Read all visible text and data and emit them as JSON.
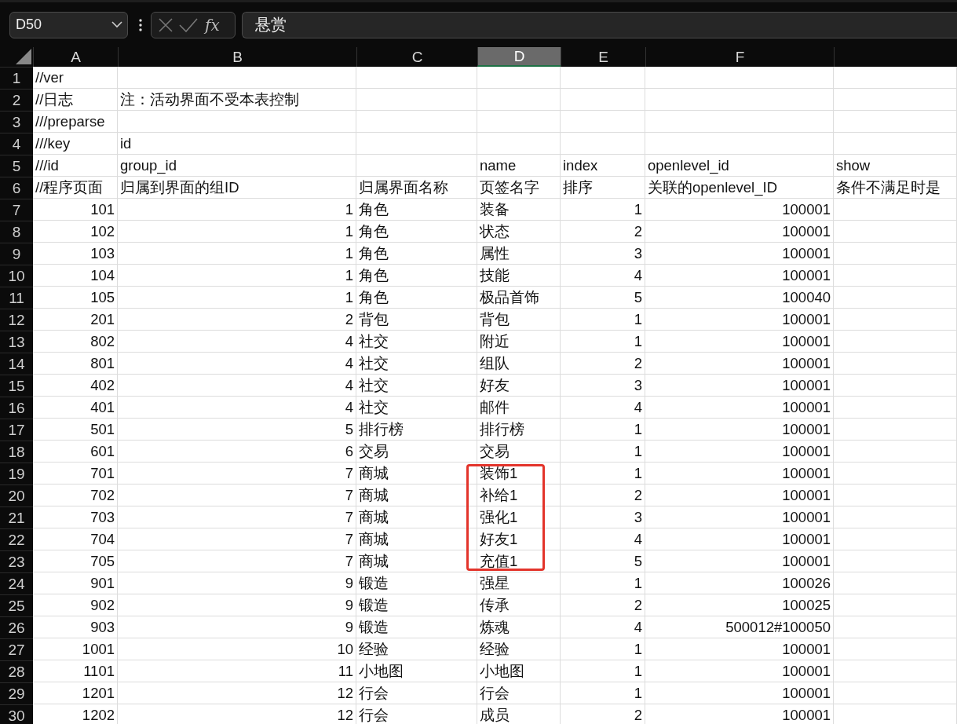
{
  "formula_bar": {
    "name_box": "D50",
    "function_label": "fx",
    "formula": "悬赏"
  },
  "columns": [
    {
      "label": "A",
      "selected": false
    },
    {
      "label": "B",
      "selected": false
    },
    {
      "label": "C",
      "selected": false
    },
    {
      "label": "D",
      "selected": true
    },
    {
      "label": "E",
      "selected": false
    },
    {
      "label": "F",
      "selected": false
    },
    {
      "selected": false
    }
  ],
  "rows": [
    {
      "number": "1",
      "kind": "header",
      "cells": [
        "//ver",
        null,
        null,
        null,
        null,
        null,
        null
      ]
    },
    {
      "number": "2",
      "kind": "header",
      "cells": [
        "//日志",
        "注：活动界面不受本表控制",
        null,
        null,
        null,
        null,
        null
      ]
    },
    {
      "number": "3",
      "kind": "header",
      "cells": [
        "///preparse",
        null,
        null,
        null,
        null,
        null,
        null
      ]
    },
    {
      "number": "4",
      "kind": "header",
      "cells": [
        "///key",
        "id",
        null,
        null,
        null,
        null,
        null
      ]
    },
    {
      "number": "5",
      "kind": "header",
      "cells": [
        "///id",
        "group_id",
        null,
        "name",
        "index",
        "openlevel_id",
        "show"
      ]
    },
    {
      "number": "6",
      "kind": "header",
      "cells": [
        "//程序页面",
        "归属到界面的组ID",
        "归属界面名称",
        "页签名字",
        "排序",
        "关联的openlevel_ID",
        "条件不满足时是"
      ]
    },
    {
      "number": "7",
      "kind": "data",
      "boxed": false,
      "cells": [
        "101",
        "1",
        "角色",
        "装备",
        "1",
        "100001",
        null
      ]
    },
    {
      "number": "8",
      "kind": "data",
      "boxed": false,
      "cells": [
        "102",
        "1",
        "角色",
        "状态",
        "2",
        "100001",
        null
      ]
    },
    {
      "number": "9",
      "kind": "data",
      "boxed": false,
      "cells": [
        "103",
        "1",
        "角色",
        "属性",
        "3",
        "100001",
        null
      ]
    },
    {
      "number": "10",
      "kind": "data",
      "boxed": false,
      "cells": [
        "104",
        "1",
        "角色",
        "技能",
        "4",
        "100001",
        null
      ]
    },
    {
      "number": "11",
      "kind": "data",
      "boxed": false,
      "cells": [
        "105",
        "1",
        "角色",
        "极品首饰",
        "5",
        "100040",
        null
      ]
    },
    {
      "number": "12",
      "kind": "data",
      "boxed": false,
      "cells": [
        "201",
        "2",
        "背包",
        "背包",
        "1",
        "100001",
        null
      ]
    },
    {
      "number": "13",
      "kind": "data",
      "boxed": false,
      "cells": [
        "802",
        "4",
        "社交",
        "附近",
        "1",
        "100001",
        null
      ]
    },
    {
      "number": "14",
      "kind": "data",
      "boxed": false,
      "cells": [
        "801",
        "4",
        "社交",
        "组队",
        "2",
        "100001",
        null
      ]
    },
    {
      "number": "15",
      "kind": "data",
      "boxed": false,
      "cells": [
        "402",
        "4",
        "社交",
        "好友",
        "3",
        "100001",
        null
      ]
    },
    {
      "number": "16",
      "kind": "data",
      "boxed": false,
      "cells": [
        "401",
        "4",
        "社交",
        "邮件",
        "4",
        "100001",
        null
      ]
    },
    {
      "number": "17",
      "kind": "data",
      "boxed": false,
      "cells": [
        "501",
        "5",
        "排行榜",
        "排行榜",
        "1",
        "100001",
        null
      ]
    },
    {
      "number": "18",
      "kind": "data",
      "boxed": false,
      "cells": [
        "601",
        "6",
        "交易",
        "交易",
        "1",
        "100001",
        null
      ]
    },
    {
      "number": "19",
      "kind": "data",
      "boxed": true,
      "cells": [
        "701",
        "7",
        "商城",
        "装饰1",
        "1",
        "100001",
        null
      ]
    },
    {
      "number": "20",
      "kind": "data",
      "boxed": true,
      "cells": [
        "702",
        "7",
        "商城",
        "补给1",
        "2",
        "100001",
        null
      ]
    },
    {
      "number": "21",
      "kind": "data",
      "boxed": true,
      "cells": [
        "703",
        "7",
        "商城",
        "强化1",
        "3",
        "100001",
        null
      ]
    },
    {
      "number": "22",
      "kind": "data",
      "boxed": true,
      "cells": [
        "704",
        "7",
        "商城",
        "好友1",
        "4",
        "100001",
        null
      ]
    },
    {
      "number": "23",
      "kind": "data",
      "boxed": true,
      "cells": [
        "705",
        "7",
        "商城",
        "充值1",
        "5",
        "100001",
        null
      ]
    },
    {
      "number": "24",
      "kind": "data",
      "boxed": false,
      "cells": [
        "901",
        "9",
        "锻造",
        "强星",
        "1",
        "100026",
        null
      ]
    },
    {
      "number": "25",
      "kind": "data",
      "boxed": false,
      "cells": [
        "902",
        "9",
        "锻造",
        "传承",
        "2",
        "100025",
        null
      ]
    },
    {
      "number": "26",
      "kind": "data",
      "boxed": false,
      "cells": [
        "903",
        "9",
        "锻造",
        "炼魂",
        "4",
        "500012#100050",
        null
      ]
    },
    {
      "number": "27",
      "kind": "data",
      "boxed": false,
      "cells": [
        "1001",
        "10",
        "经验",
        "经验",
        "1",
        "100001",
        null
      ]
    },
    {
      "number": "28",
      "kind": "data",
      "boxed": false,
      "cells": [
        "1101",
        "11",
        "小地图",
        "小地图",
        "1",
        "100001",
        null
      ]
    },
    {
      "number": "29",
      "kind": "data",
      "boxed": false,
      "cells": [
        "1201",
        "12",
        "行会",
        "行会",
        "1",
        "100001",
        null
      ]
    },
    {
      "number": "30",
      "kind": "data",
      "boxed": false,
      "cells": [
        "1202",
        "12",
        "行会",
        "成员",
        "2",
        "100001",
        null
      ]
    }
  ]
}
